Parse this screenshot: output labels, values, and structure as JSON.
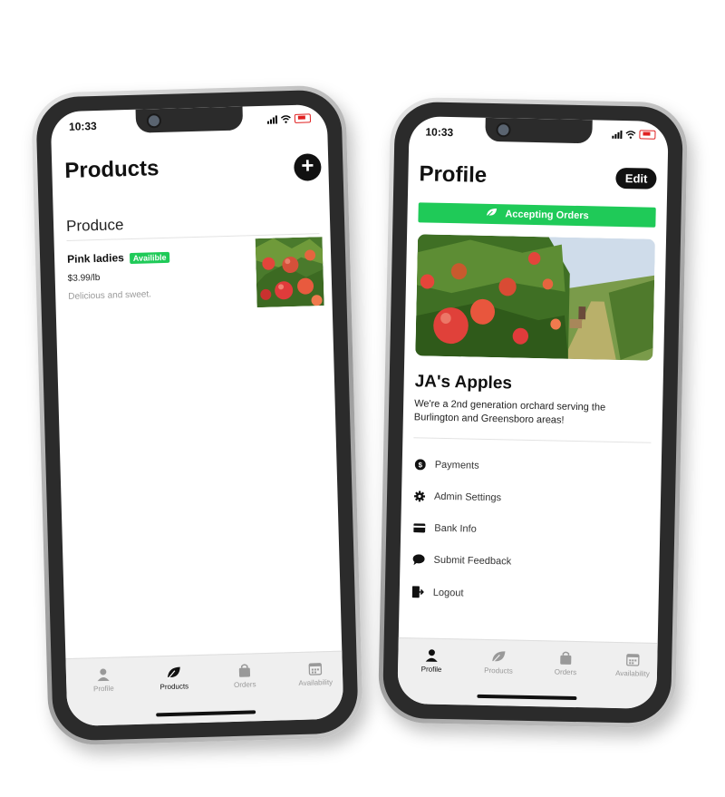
{
  "products_screen": {
    "status_time": "10:33",
    "title": "Products",
    "add_label": "+",
    "section": "Produce",
    "product": {
      "name": "Pink ladies",
      "badge": "Availible",
      "price": "$3.99/lb",
      "description": "Delicious and sweet."
    },
    "tabs": [
      {
        "label": "Profile",
        "icon": "person-icon"
      },
      {
        "label": "Products",
        "icon": "leaf-icon"
      },
      {
        "label": "Orders",
        "icon": "bag-icon"
      },
      {
        "label": "Availability",
        "icon": "calendar-icon"
      }
    ],
    "active_tab": "Products"
  },
  "profile_screen": {
    "status_time": "10:33",
    "title": "Profile",
    "edit_label": "Edit",
    "accepting_label": "Accepting Orders",
    "business_name": "JA's Apples",
    "business_description": "We're a 2nd generation orchard serving the Burlington and Greensboro areas!",
    "menu": [
      {
        "label": "Payments",
        "icon": "dollar-circle-icon"
      },
      {
        "label": "Admin Settings",
        "icon": "gear-icon"
      },
      {
        "label": "Bank Info",
        "icon": "credit-card-icon"
      },
      {
        "label": "Submit Feedback",
        "icon": "chat-bubble-icon"
      },
      {
        "label": "Logout",
        "icon": "logout-icon"
      }
    ],
    "tabs": [
      {
        "label": "Profile",
        "icon": "person-icon"
      },
      {
        "label": "Products",
        "icon": "leaf-icon"
      },
      {
        "label": "Orders",
        "icon": "bag-icon"
      },
      {
        "label": "Availability",
        "icon": "calendar-icon"
      }
    ],
    "active_tab": "Profile"
  },
  "colors": {
    "accent_green": "#1fca58",
    "dark": "#111111",
    "tab_inactive": "#999999"
  }
}
